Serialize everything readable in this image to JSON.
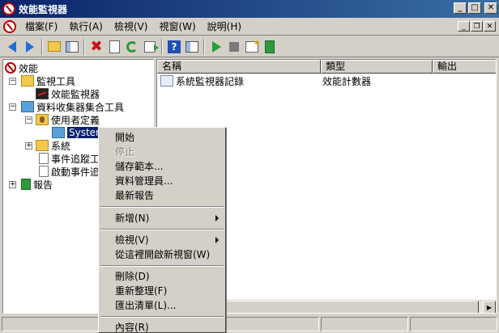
{
  "window": {
    "title": "效能監視器"
  },
  "menubar": {
    "items": [
      "檔案(F)",
      "執行(A)",
      "檢視(V)",
      "視窗(W)",
      "說明(H)"
    ]
  },
  "toolbar": {
    "icons": [
      "arrow-left-icon",
      "arrow-right-icon",
      "folder-up-icon",
      "show-hide-tree-icon",
      "delete-icon",
      "properties-icon",
      "refresh-icon",
      "export-icon",
      "help-icon",
      "show-pane-icon",
      "start-icon",
      "stop-icon",
      "new-icon",
      "report-icon"
    ]
  },
  "tree": {
    "nodes": [
      {
        "label": "效能",
        "expander": ""
      },
      {
        "label": "監視工具",
        "expander": "−"
      },
      {
        "label": "效能監視器",
        "expander": ""
      },
      {
        "label": "資料收集器集合工具",
        "expander": "−"
      },
      {
        "label": "使用者定義",
        "expander": "−"
      },
      {
        "label": "System",
        "expander": ""
      },
      {
        "label": "系統",
        "expander": "+"
      },
      {
        "label": "事件追蹤工",
        "expander": ""
      },
      {
        "label": "啟動事件追",
        "expander": ""
      },
      {
        "label": "報告",
        "expander": "+"
      }
    ]
  },
  "list": {
    "columns": [
      "名稱",
      "類型",
      "輸出"
    ],
    "rows": [
      {
        "name": "系統監視器記錄",
        "type": "效能計數器",
        "output": ""
      }
    ]
  },
  "context_menu": {
    "items": [
      {
        "label": "開始",
        "disabled": false
      },
      {
        "label": "停止",
        "disabled": true
      },
      {
        "label": "儲存範本...",
        "disabled": false
      },
      {
        "label": "資料管理員...",
        "disabled": false
      },
      {
        "label": "最新報告",
        "disabled": false
      },
      {
        "label": "新增(N)",
        "disabled": false
      },
      {
        "label": "檢視(V)",
        "disabled": false
      },
      {
        "label": "從這裡開啟新視窗(W)",
        "disabled": false
      },
      {
        "label": "刪除(D)",
        "disabled": false
      },
      {
        "label": "重新整理(F)",
        "disabled": false
      },
      {
        "label": "匯出清單(L)...",
        "disabled": false
      },
      {
        "label": "內容(R)",
        "disabled": false
      }
    ]
  },
  "colors": {
    "titlebar_start": "#0a246a",
    "titlebar_end": "#3a6ea5",
    "selection": "#0a246a",
    "chrome": "#d4d0c8"
  }
}
